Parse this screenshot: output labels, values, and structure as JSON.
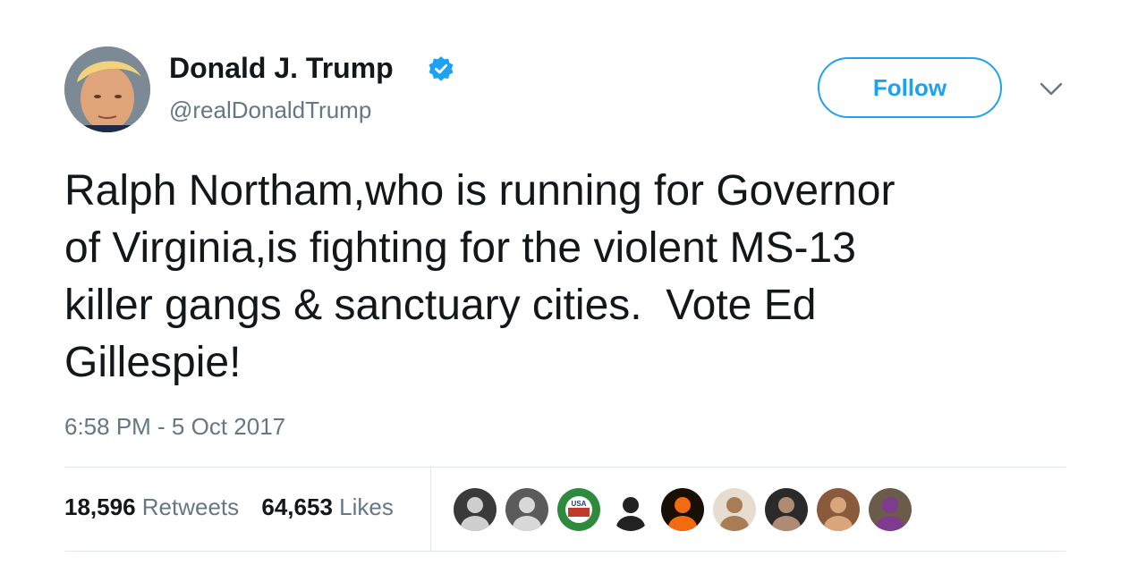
{
  "tweet": {
    "display_name": "Donald J. Trump",
    "handle": "@realDonaldTrump",
    "follow_label": "Follow",
    "text": "Ralph Northam,who is running for Governor\nof Virginia,is fighting for the violent MS-13\nkiller gangs & sanctuary cities.  Vote Ed\nGillespie!",
    "timestamp": "6:58 PM - 5 Oct 2017"
  },
  "stats": {
    "retweets_count": "18,596",
    "retweets_label": "Retweets",
    "likes_count": "64,653",
    "likes_label": "Likes"
  },
  "likers": [
    {
      "icon": "liker-avatar-1",
      "bg": "#3a3a3a",
      "fg": "#cfcfcf"
    },
    {
      "icon": "liker-avatar-2",
      "bg": "#5b5b5b",
      "fg": "#d8d8d8"
    },
    {
      "icon": "liker-avatar-3",
      "bg": "#2e8b3d",
      "fg": "#ffffff",
      "label": "USA"
    },
    {
      "icon": "liker-avatar-4",
      "bg": "#ffffff",
      "fg": "#222222"
    },
    {
      "icon": "liker-avatar-5",
      "bg": "#1a0f05",
      "fg": "#f26b0f"
    },
    {
      "icon": "liker-avatar-6",
      "bg": "#e6dccf",
      "fg": "#a97d53"
    },
    {
      "icon": "liker-avatar-7",
      "bg": "#2a2a2a",
      "fg": "#b08b73"
    },
    {
      "icon": "liker-avatar-8",
      "bg": "#8a5a3c",
      "fg": "#d9a57b"
    },
    {
      "icon": "liker-avatar-9",
      "bg": "#6b5b4a",
      "fg": "#7d3c8e"
    }
  ],
  "colors": {
    "accent": "#1da1f2",
    "text": "#14171a",
    "secondary": "#657786",
    "divider": "#e1e8ed"
  }
}
